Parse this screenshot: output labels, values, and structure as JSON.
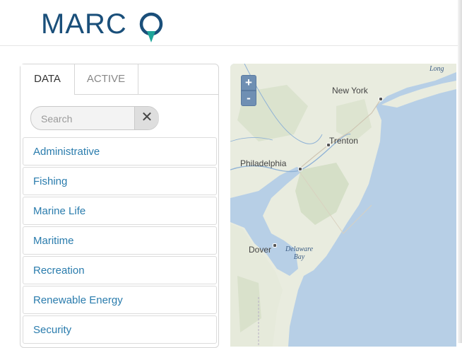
{
  "header": {
    "logo_text": "MARC",
    "logo_pin_letter": "O",
    "brand_color": "#1a4f7a",
    "pin_color": "#1ea59a"
  },
  "sidebar": {
    "tabs": [
      {
        "label": "DATA",
        "selected": true
      },
      {
        "label": "ACTIVE",
        "selected": false
      }
    ],
    "search": {
      "placeholder": "Search",
      "value": "",
      "clear_icon": "close-icon"
    },
    "categories": [
      {
        "label": "Administrative"
      },
      {
        "label": "Fishing"
      },
      {
        "label": "Marine Life"
      },
      {
        "label": "Maritime"
      },
      {
        "label": "Recreation"
      },
      {
        "label": "Renewable Energy"
      },
      {
        "label": "Security"
      }
    ],
    "link_color": "#2a7cad"
  },
  "map": {
    "zoom_in_label": "+",
    "zoom_out_label": "-",
    "labels": {
      "new_york": "New York",
      "trenton": "Trenton",
      "philadelphia": "Philadelphia",
      "dover": "Dover",
      "delaware_bay_1": "Delaware",
      "delaware_bay_2": "Bay",
      "long": "Long"
    },
    "colors": {
      "water": "#b7cfe6",
      "land": "#e9ecdf",
      "forest": "#cfdcc0"
    }
  }
}
